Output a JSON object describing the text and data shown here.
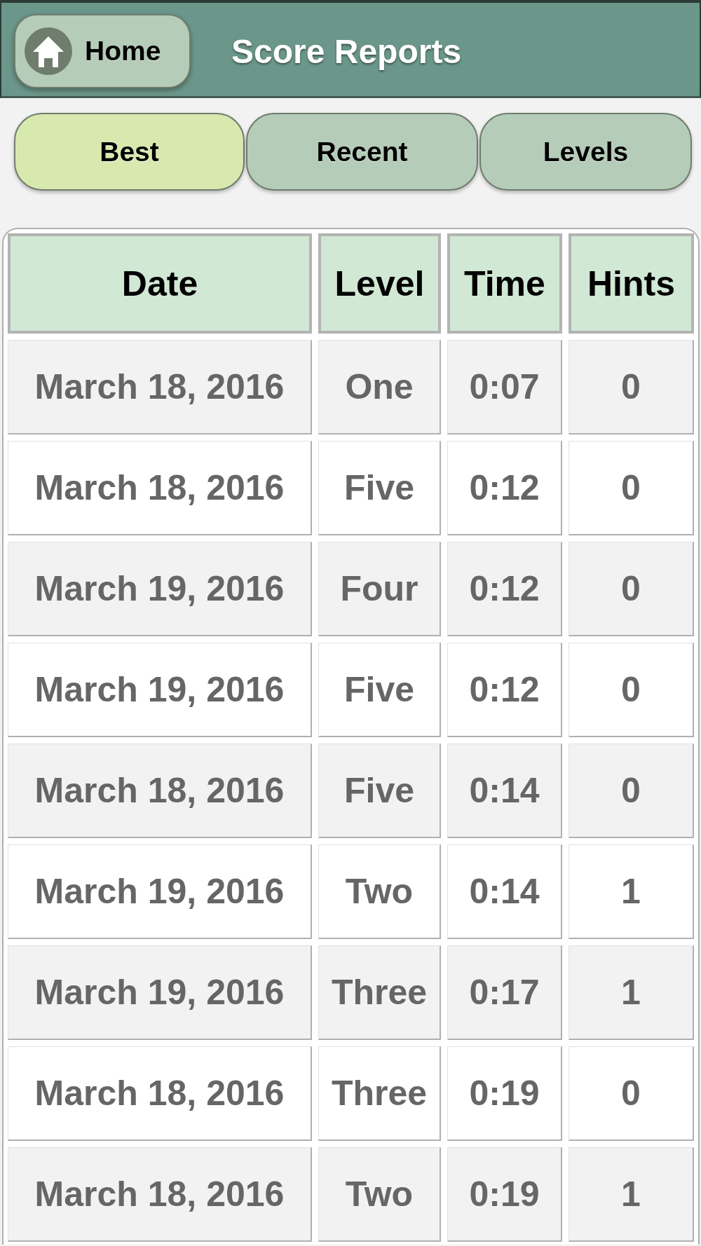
{
  "header": {
    "home_button": {
      "label": "Home"
    },
    "title": "Score Reports"
  },
  "tabs": [
    {
      "label": "Best",
      "selected": true
    },
    {
      "label": "Recent",
      "selected": false
    },
    {
      "label": "Levels",
      "selected": false
    }
  ],
  "table": {
    "columns": [
      "Date",
      "Level",
      "Time",
      "Hints"
    ],
    "rows": [
      [
        "March 18, 2016",
        "One",
        "0:07",
        "0"
      ],
      [
        "March 18, 2016",
        "Five",
        "0:12",
        "0"
      ],
      [
        "March 19, 2016",
        "Four",
        "0:12",
        "0"
      ],
      [
        "March 19, 2016",
        "Five",
        "0:12",
        "0"
      ],
      [
        "March 18, 2016",
        "Five",
        "0:14",
        "0"
      ],
      [
        "March 19, 2016",
        "Two",
        "0:14",
        "1"
      ],
      [
        "March 19, 2016",
        "Three",
        "0:17",
        "1"
      ],
      [
        "March 18, 2016",
        "Three",
        "0:19",
        "0"
      ],
      [
        "March 18, 2016",
        "Two",
        "0:19",
        "1"
      ]
    ]
  }
}
